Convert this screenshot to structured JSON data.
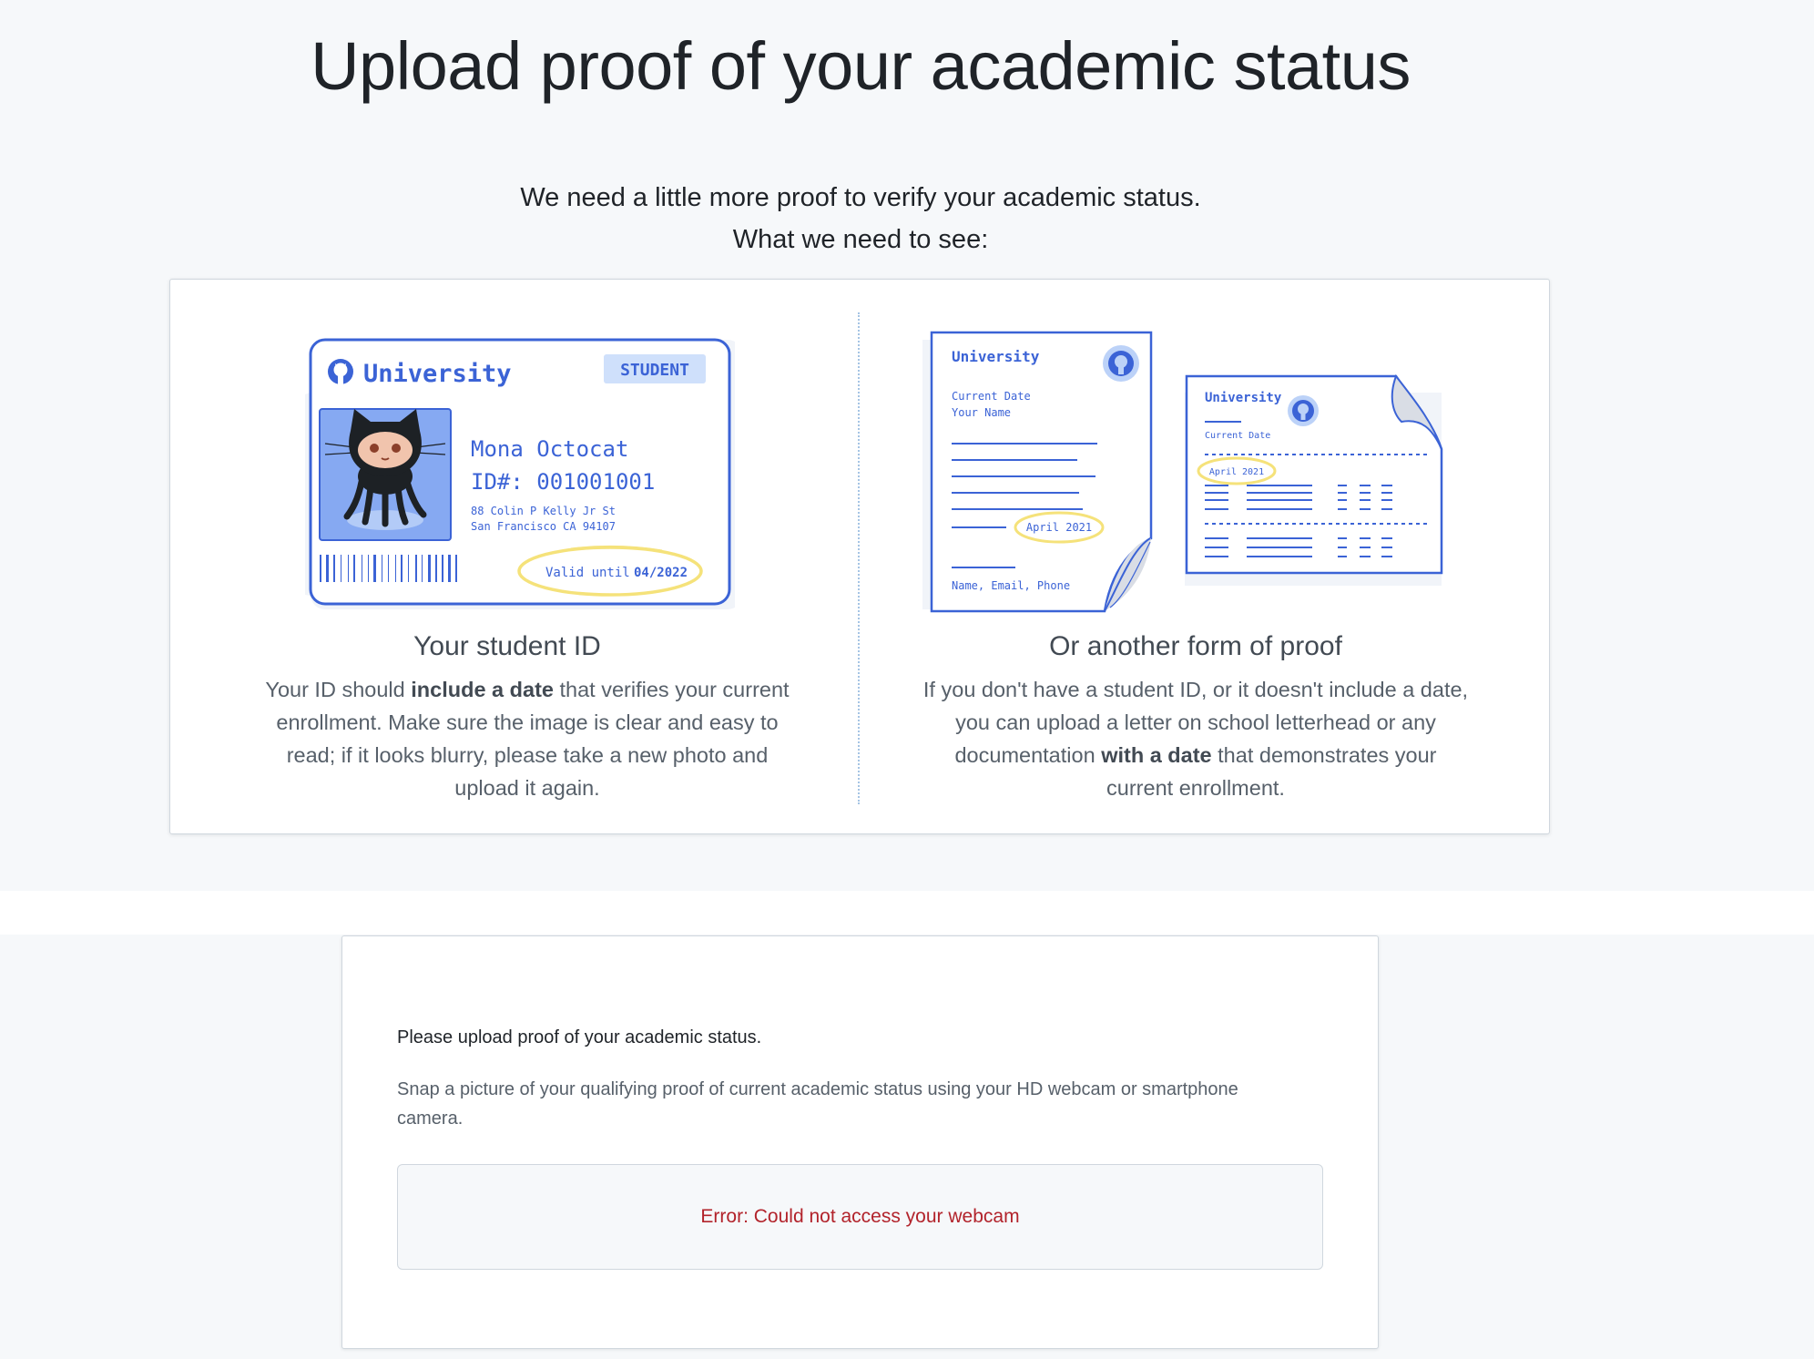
{
  "page": {
    "title": "Upload proof of your academic status",
    "intro_line1": "We need a little more proof to verify your academic status.",
    "intro_line2": "What we need to see:"
  },
  "student_id": {
    "card": {
      "university": "University",
      "badge": "STUDENT",
      "name": "Mona Octocat",
      "id_number": "ID#: 001001001",
      "address_line1": "88 Colin P Kelly Jr St",
      "address_line2": "San Francisco CA 94107",
      "valid_label": "Valid until",
      "valid_date": "04/2022"
    },
    "title": "Your student ID",
    "body_pre": "Your ID should ",
    "body_bold": "include a date",
    "body_post": " that verifies your current enrollment. Make sure the image is clear and easy to read; if it looks blurry, please take a new photo and upload it again."
  },
  "other_proof": {
    "doc1": {
      "university": "University",
      "current_date": "Current Date",
      "your_name": "Your Name",
      "date": "April 2021",
      "footer": "Name, Email, Phone"
    },
    "doc2": {
      "university": "University",
      "current_date": "Current Date",
      "date": "April 2021"
    },
    "title": "Or another form of proof",
    "body_pre": "If you don't have a student ID, or it doesn't include a date, you can upload a letter on school letterhead or any documentation ",
    "body_bold": "with a date",
    "body_post": " that demonstrates your current enrollment."
  },
  "upload": {
    "heading": "Please upload proof of your academic status.",
    "description": "Snap a picture of your qualifying proof of current academic status using your HD webcam or smartphone camera.",
    "error": "Error: Could not access your webcam"
  },
  "colors": {
    "illustration_blue": "#3b63d6",
    "highlight_yellow": "#f5e27a",
    "photo_blue": "#86a9f2",
    "error_red": "#b2232b"
  }
}
